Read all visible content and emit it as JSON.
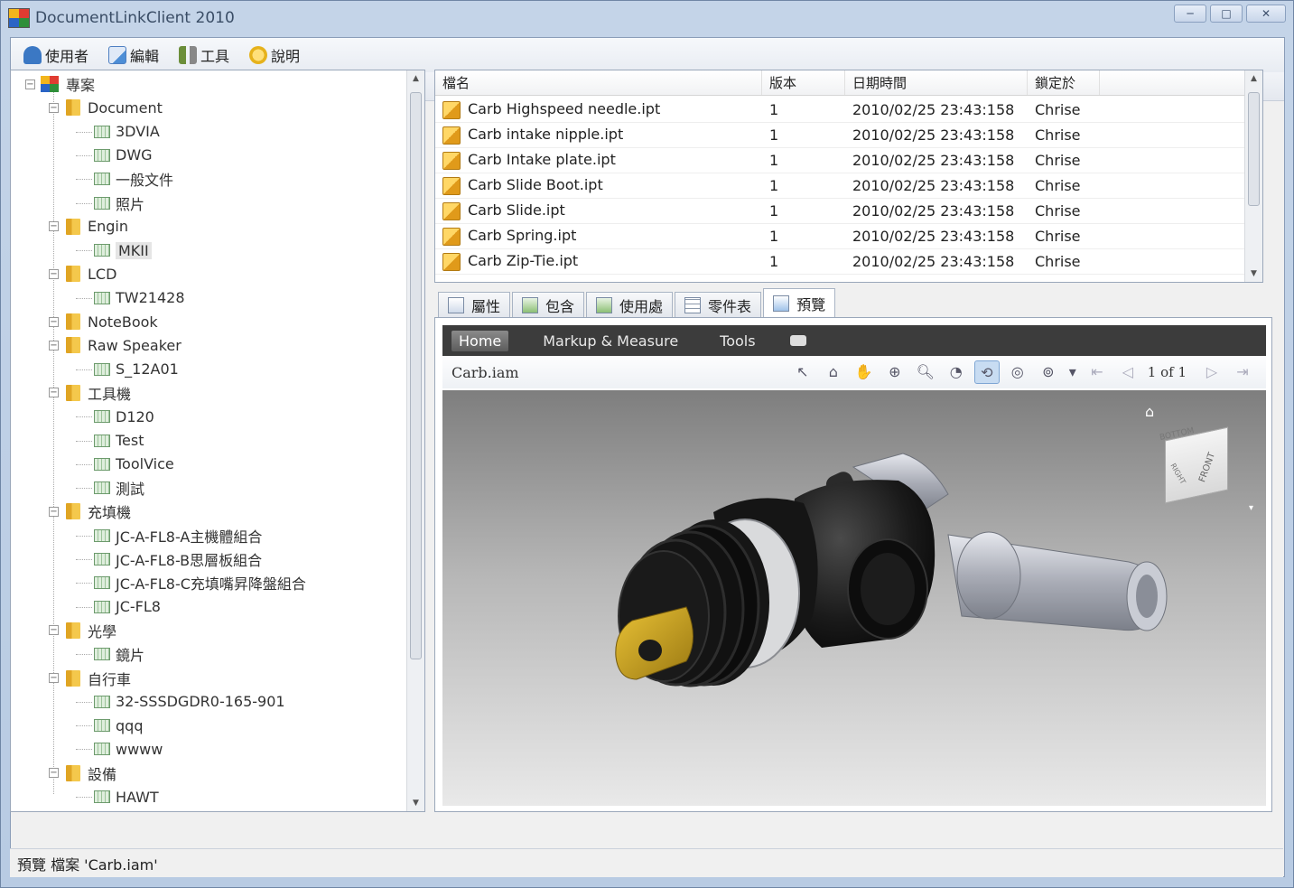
{
  "window": {
    "title": "DocumentLinkClient 2010",
    "buttons": [
      "─",
      "□",
      "✕"
    ]
  },
  "menu": [
    {
      "label": "使用者",
      "icon": "user-icon",
      "color": "#3b78c4"
    },
    {
      "label": "編輯",
      "icon": "edit-icon",
      "color": "#4d8ed6"
    },
    {
      "label": "工具",
      "icon": "tools-icon",
      "color": "#6b8e3a"
    },
    {
      "label": "說明",
      "icon": "help-icon",
      "color": "#e6b21c"
    }
  ],
  "tree": {
    "root": "專案",
    "nodes": [
      {
        "label": "Document",
        "type": "folder"
      },
      {
        "label": "3DVIA",
        "type": "doc"
      },
      {
        "label": "DWG",
        "type": "doc"
      },
      {
        "label": "一般文件",
        "type": "doc"
      },
      {
        "label": "照片",
        "type": "doc"
      },
      {
        "label": "Engin",
        "type": "folder"
      },
      {
        "label": "MKII",
        "type": "doc"
      },
      {
        "label": "LCD",
        "type": "folder"
      },
      {
        "label": "TW21428",
        "type": "doc"
      },
      {
        "label": "NoteBook",
        "type": "folder"
      },
      {
        "label": "Raw Speaker",
        "type": "folder"
      },
      {
        "label": "S_12A01",
        "type": "doc"
      },
      {
        "label": "工具機",
        "type": "folder"
      },
      {
        "label": "D120",
        "type": "doc"
      },
      {
        "label": "Test",
        "type": "doc"
      },
      {
        "label": "ToolVice",
        "type": "doc"
      },
      {
        "label": "測試",
        "type": "doc"
      },
      {
        "label": "充填機",
        "type": "folder"
      },
      {
        "label": "JC-A-FL8-A主機體組合",
        "type": "doc"
      },
      {
        "label": "JC-A-FL8-B思層板組合",
        "type": "doc"
      },
      {
        "label": "JC-A-FL8-C充填嘴昇降盤組合",
        "type": "doc"
      },
      {
        "label": "JC-FL8",
        "type": "doc"
      },
      {
        "label": "光學",
        "type": "folder"
      },
      {
        "label": "鏡片",
        "type": "doc"
      },
      {
        "label": "自行車",
        "type": "folder"
      },
      {
        "label": "32-SSSDGDR0-165-901",
        "type": "doc"
      },
      {
        "label": "qqq",
        "type": "doc"
      },
      {
        "label": "wwww",
        "type": "doc"
      },
      {
        "label": "設備",
        "type": "folder"
      },
      {
        "label": "HAWT",
        "type": "doc"
      }
    ]
  },
  "files": {
    "columns": [
      "檔名",
      "版本",
      "日期時間",
      "鎖定於"
    ],
    "rows": [
      {
        "name": "Carb Highspeed needle.ipt",
        "version": "1",
        "date": "2010/02/25 23:43:158",
        "locked": "Chrise"
      },
      {
        "name": "Carb intake nipple.ipt",
        "version": "1",
        "date": "2010/02/25 23:43:158",
        "locked": "Chrise"
      },
      {
        "name": "Carb Intake plate.ipt",
        "version": "1",
        "date": "2010/02/25 23:43:158",
        "locked": "Chrise"
      },
      {
        "name": "Carb Slide Boot.ipt",
        "version": "1",
        "date": "2010/02/25 23:43:158",
        "locked": "Chrise"
      },
      {
        "name": "Carb Slide.ipt",
        "version": "1",
        "date": "2010/02/25 23:43:158",
        "locked": "Chrise"
      },
      {
        "name": "Carb Spring.ipt",
        "version": "1",
        "date": "2010/02/25 23:43:158",
        "locked": "Chrise"
      },
      {
        "name": "Carb Zip-Tie.ipt",
        "version": "1",
        "date": "2010/02/25 23:43:158",
        "locked": "Chrise"
      }
    ]
  },
  "tabs": [
    "屬性",
    "包含",
    "使用處",
    "零件表",
    "預覽"
  ],
  "viewer": {
    "ribbon_tabs": [
      "Home",
      "Markup & Measure",
      "Tools"
    ],
    "document_name": "Carb.iam",
    "page_label": "1 of 1",
    "tool_icons": [
      "select-icon",
      "home-view-icon",
      "pan-icon",
      "zoom-window-icon",
      "zoom-icon",
      "orbit-icon",
      "constrained-orbit-icon",
      "walk-icon",
      "steering-wheel-icon",
      "dropdown-icon"
    ],
    "view_cube": {
      "top": "BOTTOM",
      "front": "FRONT",
      "side": "RIGHT"
    }
  },
  "status": "預覽 檔案 'Carb.iam'"
}
